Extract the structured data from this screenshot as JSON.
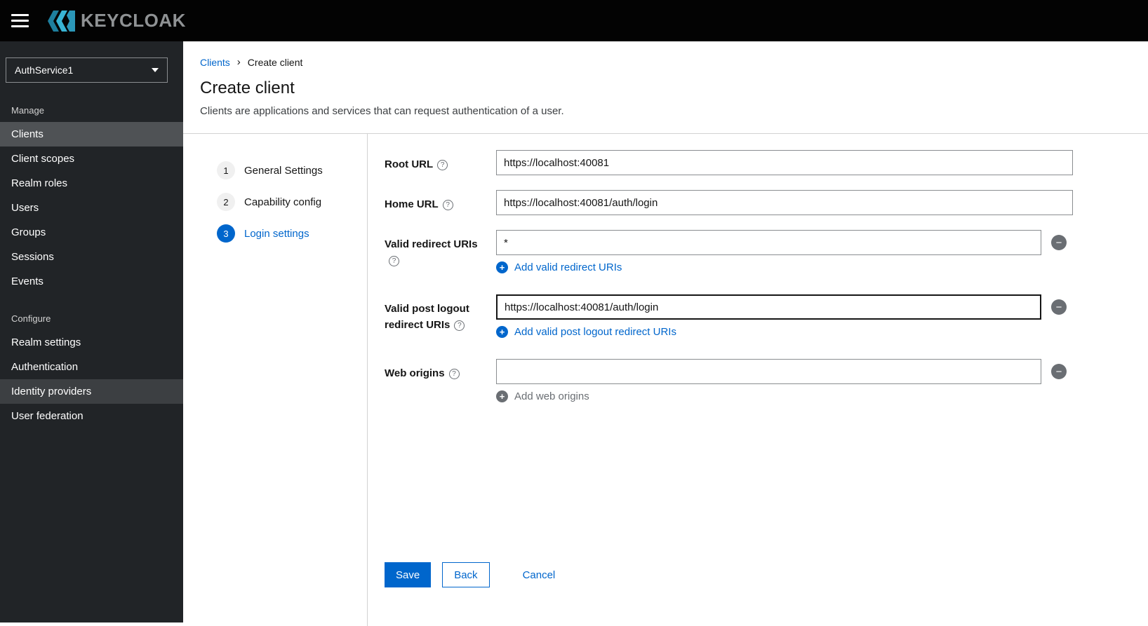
{
  "topbar": {
    "brand": "KEYCLOAK"
  },
  "sidebar": {
    "realm_selector": {
      "value": "AuthService1"
    },
    "sections": [
      {
        "label": "Manage",
        "items": [
          "Clients",
          "Client scopes",
          "Realm roles",
          "Users",
          "Groups",
          "Sessions",
          "Events"
        ]
      },
      {
        "label": "Configure",
        "items": [
          "Realm settings",
          "Authentication",
          "Identity providers",
          "User federation"
        ]
      }
    ]
  },
  "breadcrumb": {
    "items": [
      "Clients",
      "Create client"
    ]
  },
  "page": {
    "title": "Create client",
    "subtitle": "Clients are applications and services that can request authentication of a user."
  },
  "wizard": {
    "steps": [
      {
        "number": "1",
        "label": "General Settings"
      },
      {
        "number": "2",
        "label": "Capability config"
      },
      {
        "number": "3",
        "label": "Login settings"
      }
    ]
  },
  "form": {
    "fields": {
      "root_url": {
        "label": "Root URL",
        "value": "https://localhost:40081"
      },
      "home_url": {
        "label": "Home URL",
        "value": "https://localhost:40081/auth/login"
      },
      "valid_redirect_uris": {
        "label": "Valid redirect URIs",
        "value": "*",
        "add_label": "Add valid redirect URIs"
      },
      "valid_post_logout": {
        "label": "Valid post logout redirect URIs",
        "value": "https://localhost:40081/auth/login",
        "add_label": "Add valid post logout redirect URIs"
      },
      "web_origins": {
        "label": "Web origins",
        "value": "",
        "add_label": "Add web origins"
      }
    },
    "actions": {
      "save": "Save",
      "back": "Back",
      "cancel": "Cancel"
    }
  },
  "icons": {
    "minus": "−",
    "plus": "+",
    "question": "?",
    "breadcrumb_separator": "›"
  },
  "colors": {
    "accent": "#0066cc",
    "masthead_bg": "#030303",
    "sidebar_bg": "#212427",
    "sidebar_selected_bg": "#4f5255",
    "disabled_gray": "#6a6e73",
    "brand_cyan": "#39b4d4"
  }
}
